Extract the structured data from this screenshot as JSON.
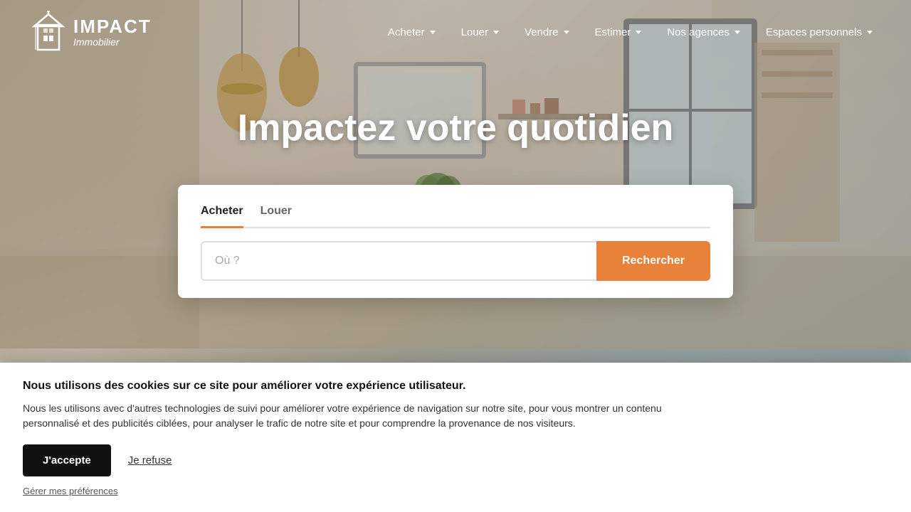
{
  "brand": {
    "name_line1": "IMPACT",
    "name_line2": "Immobilier"
  },
  "navbar": {
    "items": [
      {
        "label": "Acheter",
        "has_dropdown": true
      },
      {
        "label": "Louer",
        "has_dropdown": true
      },
      {
        "label": "Vendre",
        "has_dropdown": true
      },
      {
        "label": "Estimer",
        "has_dropdown": true
      },
      {
        "label": "Nos agences",
        "has_dropdown": true
      },
      {
        "label": "Espaces personnels",
        "has_dropdown": true
      }
    ]
  },
  "hero": {
    "title": "Impactez votre quotidien"
  },
  "search": {
    "tabs": [
      {
        "label": "Acheter",
        "active": true
      },
      {
        "label": "Louer",
        "active": false
      }
    ],
    "input_placeholder": "Où ?",
    "button_label": "Rechercher"
  },
  "cookie_banner": {
    "title": "Nous utilisons des cookies sur ce site pour améliorer votre expérience utilisateur.",
    "description": "Nous les utilisons avec d'autres technologies de suivi pour améliorer votre expérience de navigation sur notre site, pour vous montrer un contenu personnalisé et des publicités ciblées, pour analyser le trafic de notre site et pour comprendre la provenance de nos visiteurs.",
    "accept_label": "J'accepte",
    "refuse_label": "Je refuse",
    "prefs_label": "Gérer mes préférences"
  }
}
